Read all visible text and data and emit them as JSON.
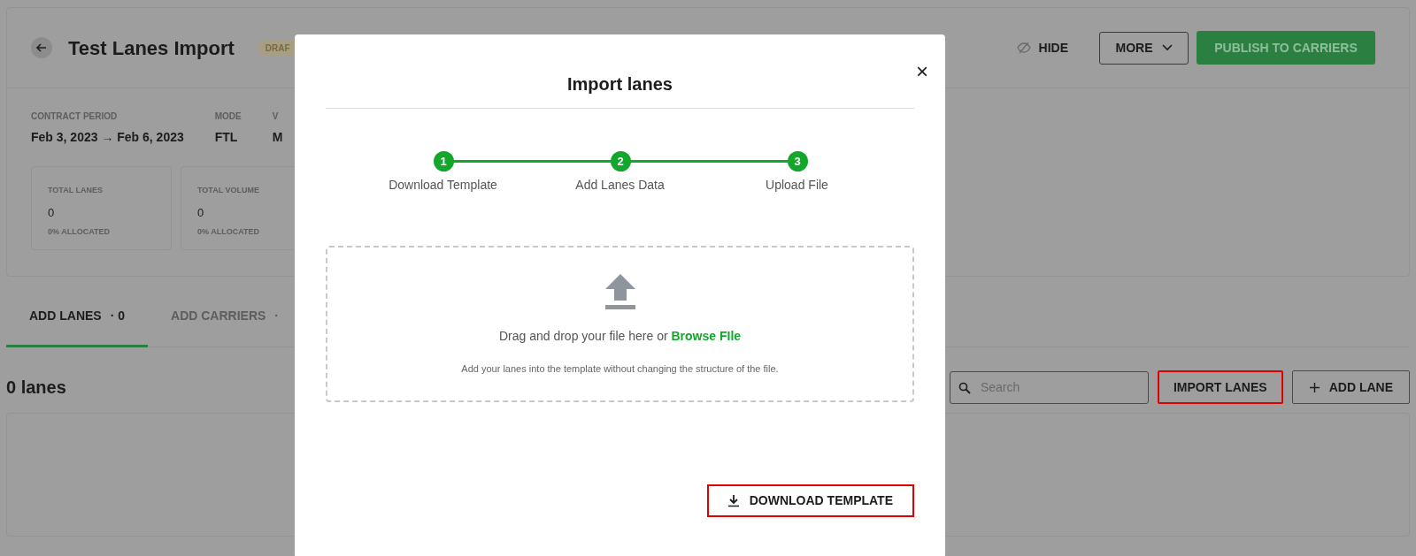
{
  "header": {
    "title": "Test Lanes Import",
    "badge": "DRAF",
    "hide_label": "HIDE",
    "more_label": "MORE",
    "publish_label": "PUBLISH TO CARRIERS"
  },
  "details": [
    {
      "label": "CONTRACT PERIOD",
      "value": "Feb 3, 2023 → Feb 6, 2023"
    },
    {
      "label": "MODE",
      "value": "FTL"
    },
    {
      "label": "V",
      "value": "M"
    }
  ],
  "stats": [
    {
      "label": "TOTAL LANES",
      "value": "0",
      "note": "0% ALLOCATED"
    },
    {
      "label": "TOTAL VOLUME",
      "value": "0",
      "note": "0% ALLOCATED"
    }
  ],
  "tabs": [
    {
      "label": "ADD LANES",
      "count": "· 0",
      "selected": true
    },
    {
      "label": "ADD CARRIERS",
      "count": "·",
      "selected": false
    }
  ],
  "lanes_heading": "0 lanes",
  "search": {
    "placeholder": "Search"
  },
  "actions": [
    {
      "kind": "import",
      "label": "IMPORT LANES",
      "highlighted": true
    },
    {
      "kind": "add",
      "label": "ADD LANE",
      "highlighted": false
    }
  ],
  "modal": {
    "title": "Import lanes",
    "close": "×",
    "steps": [
      {
        "number": "1",
        "label": "Download Template",
        "done": true
      },
      {
        "number": "2",
        "label": "Add Lanes Data",
        "done": true
      },
      {
        "number": "3",
        "label": "Upload File",
        "done": true
      }
    ],
    "drop_text": "Drag and drop your file here or",
    "browse_link": "Browse FIle",
    "hint": "Add your lanes into the template without changing the structure of the file.",
    "download_button": {
      "label": "DOWNLOAD TEMPLATE",
      "highlighted": true
    }
  }
}
